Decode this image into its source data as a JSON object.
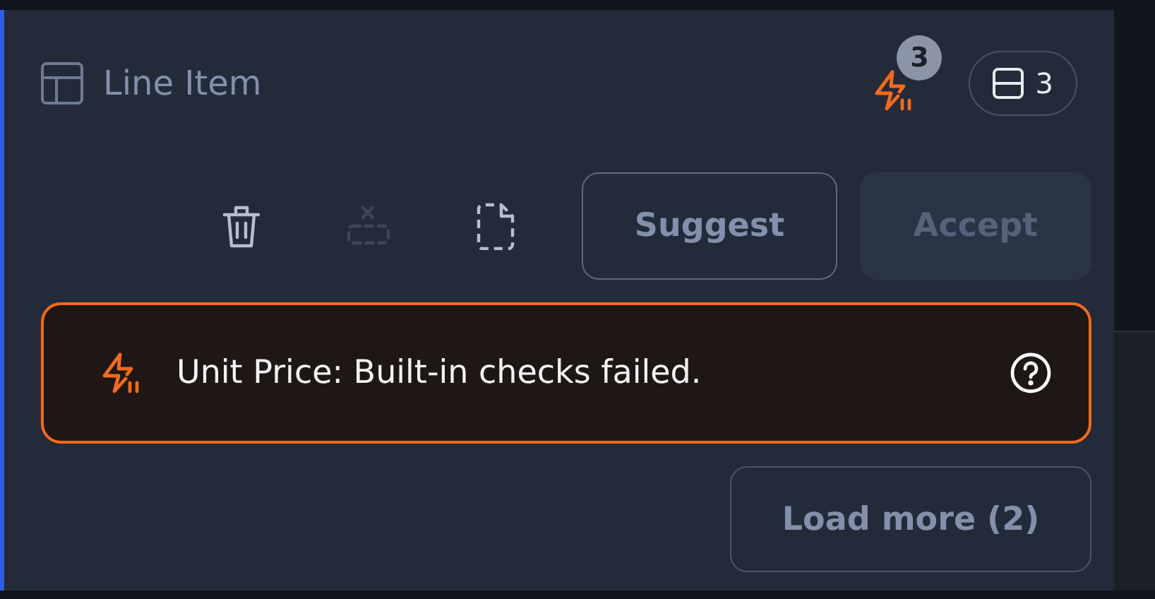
{
  "header": {
    "title": "Line Item",
    "warning_count": "3",
    "row_count": "3"
  },
  "actions": [
    {
      "kind": "trash",
      "disabled": false
    },
    {
      "kind": "dashed-remove",
      "disabled": true
    },
    {
      "kind": "file",
      "disabled": false
    }
  ],
  "buttons": [
    {
      "label": "Suggest",
      "disabled": false
    },
    {
      "label": "Accept",
      "disabled": true
    }
  ],
  "alert": {
    "message": "Unit Price: Built-in checks failed."
  },
  "load_more": {
    "label": "Load more (2)"
  }
}
